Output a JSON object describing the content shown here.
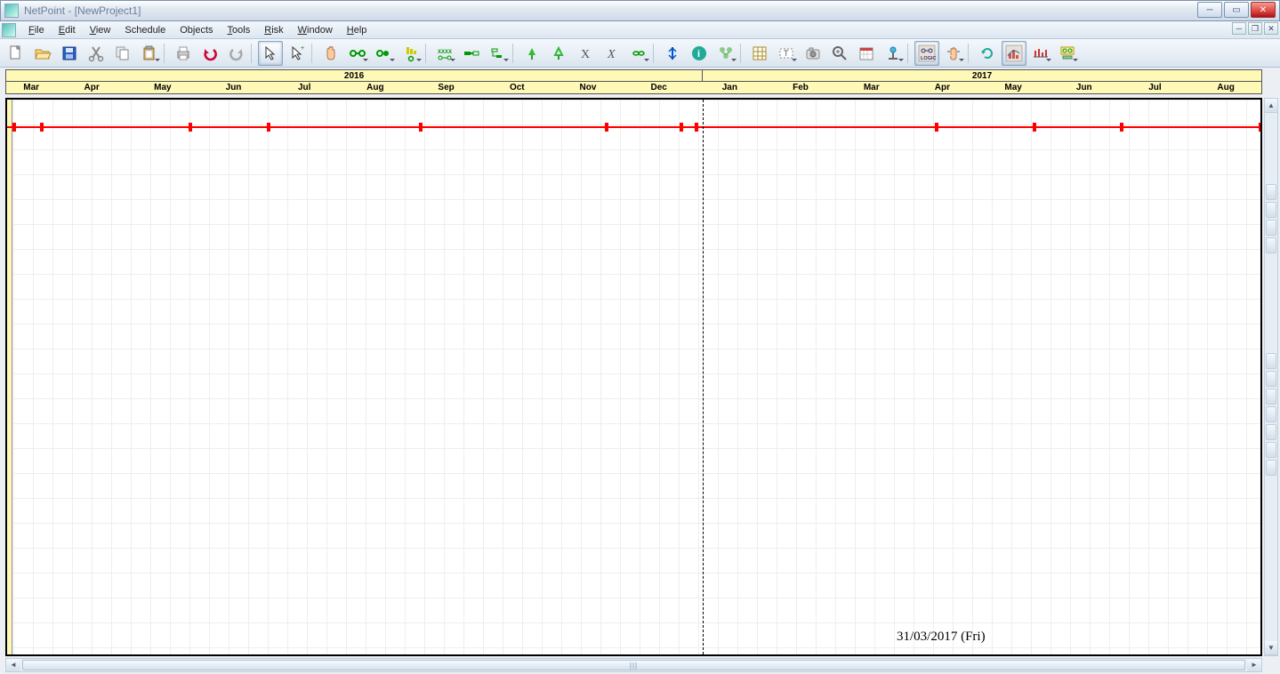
{
  "title": {
    "app": "NetPoint",
    "project": "[NewProject1]"
  },
  "menu": {
    "file": "File",
    "edit": "Edit",
    "view": "View",
    "schedule": "Schedule",
    "objects": "Objects",
    "tools": "Tools",
    "risk": "Risk",
    "window": "Window",
    "help": "Help"
  },
  "timeline": {
    "years": [
      {
        "label": "2016",
        "widthPct": 55.5
      },
      {
        "label": "2017",
        "widthPct": 44.5
      }
    ],
    "months": [
      "Mar",
      "Apr",
      "May",
      "Jun",
      "Jul",
      "Aug",
      "Sep",
      "Oct",
      "Nov",
      "Dec",
      "Jan",
      "Feb",
      "Mar",
      "Apr",
      "May",
      "Jun",
      "Jul",
      "Aug"
    ],
    "month_firstWidthPct": 4.0,
    "month_widthPct": 5.66
  },
  "canvas": {
    "date_label": "31/03/2017 (Fri)",
    "year_divider_leftPct": 55.5,
    "tick_positionsPct": [
      0.6,
      2.8,
      14.6,
      20.9,
      33.0,
      47.8,
      53.8,
      55.0,
      74.2,
      82.0,
      88.9,
      100.0
    ]
  }
}
